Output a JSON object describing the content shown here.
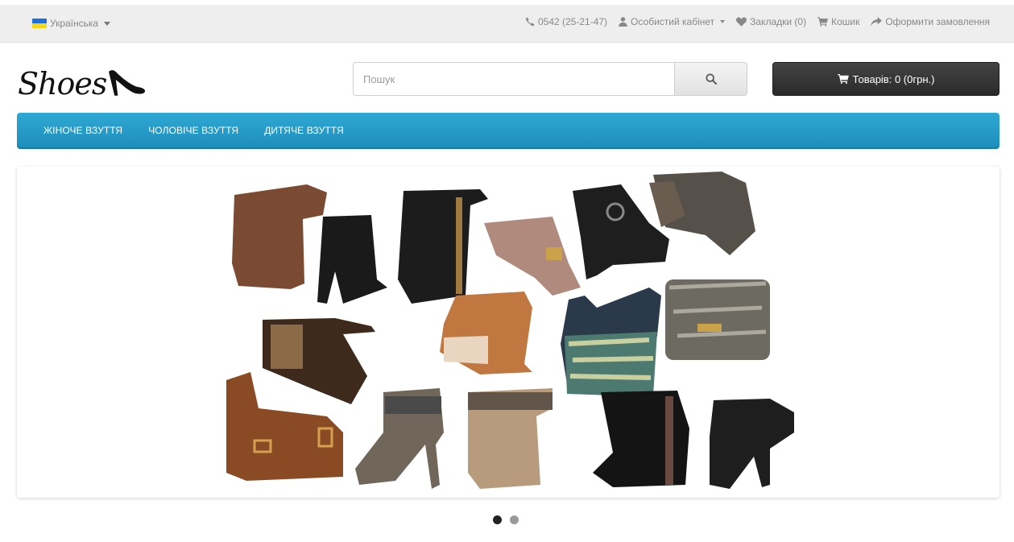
{
  "topbar": {
    "language": "Українська",
    "phone": "0542 (25-21-47)",
    "account": "Особистий кабінет",
    "wishlist": "Закладки (0)",
    "cart": "Кошик",
    "checkout": "Оформити замовлення"
  },
  "header": {
    "logo_text": "Shoes",
    "search_placeholder": "Пошук",
    "cart_button": "Товарів: 0 (0грн.)"
  },
  "nav": {
    "items": [
      {
        "label": "Жіноче взуття"
      },
      {
        "label": "Чоловіче взуття"
      },
      {
        "label": "Дитяче взуття"
      }
    ]
  },
  "slider": {
    "active_index": 0,
    "dot_count": 2
  },
  "colors": {
    "nav_bg": "#2aa0cc",
    "cart_button_bg": "#333333",
    "topbar_bg": "#eeeeee"
  }
}
